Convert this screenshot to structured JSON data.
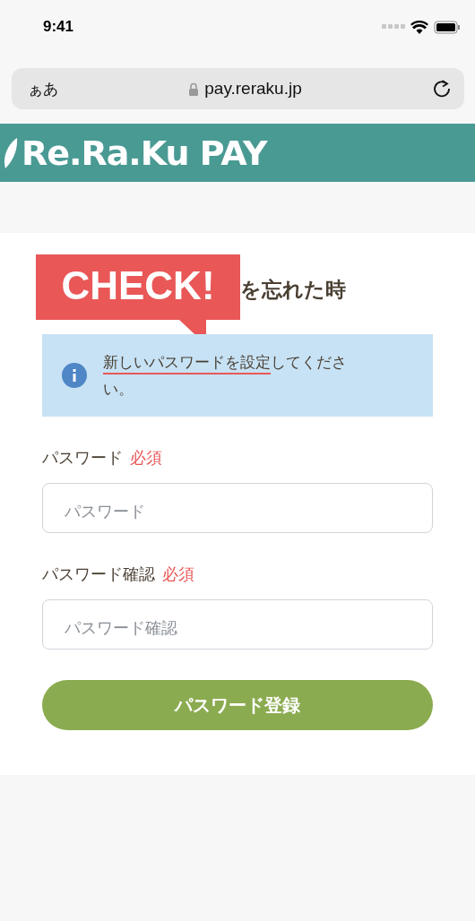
{
  "status_bar": {
    "time": "9:41"
  },
  "browser": {
    "text_size": "ぁあ",
    "url": "pay.reraku.jp"
  },
  "site_header": {
    "logo": "Re.Ra.Ku PAY"
  },
  "heading": "を忘れた時",
  "callout": {
    "label": "CHECK!"
  },
  "notice": {
    "underlined_part": "新しいパスワードを設定",
    "rest": "してください。"
  },
  "fields": [
    {
      "label": "パスワード",
      "required": "必須",
      "placeholder": "パスワード"
    },
    {
      "label": "パスワード確認",
      "required": "必須",
      "placeholder": "パスワード確認"
    }
  ],
  "submit": "パスワード登録"
}
